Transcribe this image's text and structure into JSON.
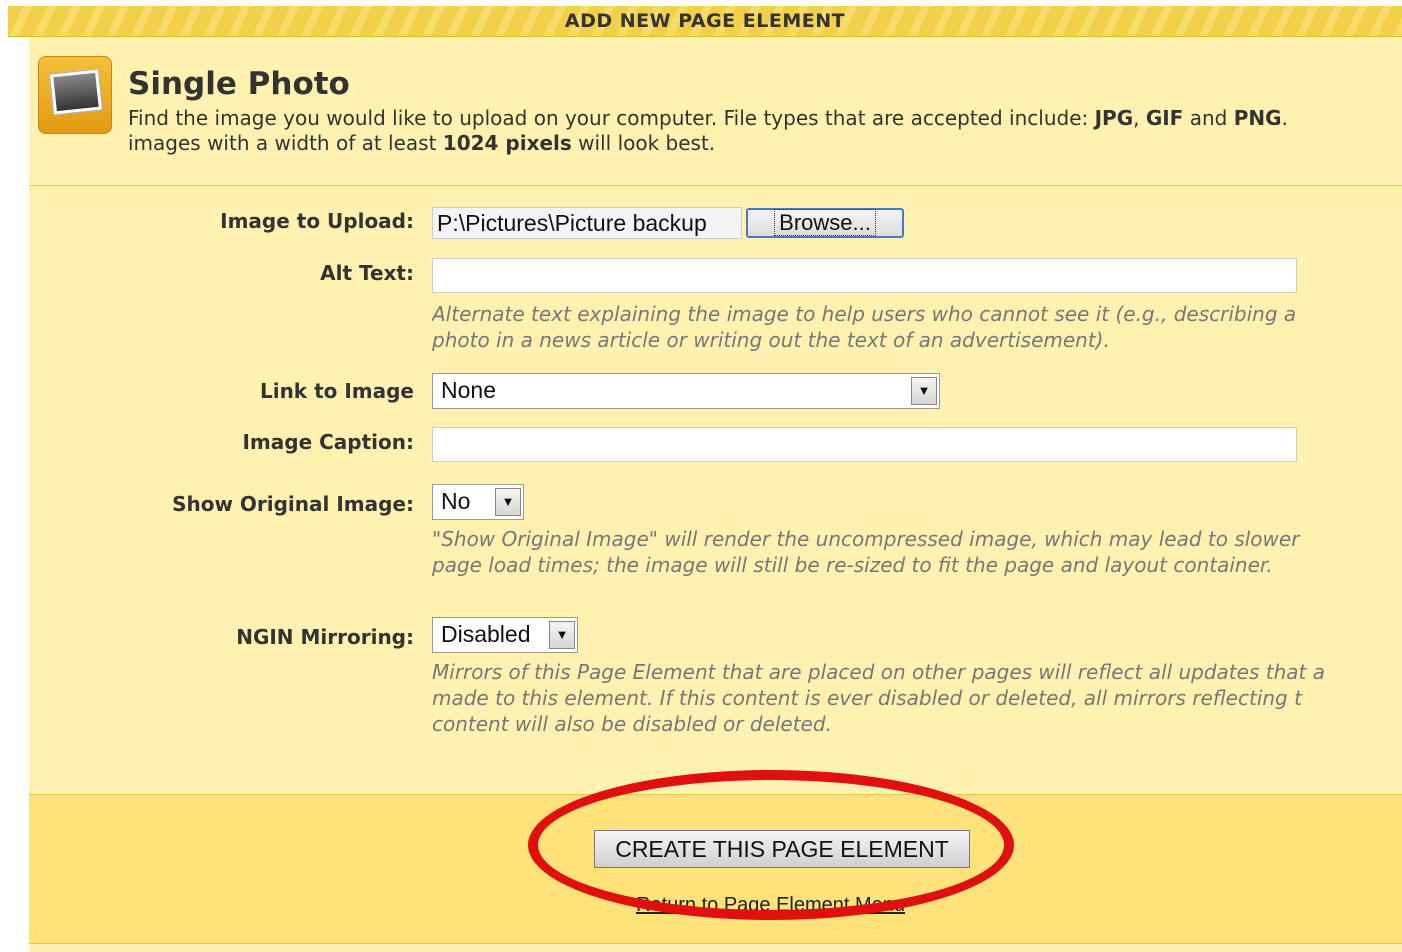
{
  "header": {
    "title": "ADD NEW PAGE ELEMENT"
  },
  "element": {
    "title": "Single Photo",
    "icon": "photo-icon",
    "desc_line1_a": "Find the image you would like to upload on your computer. File types that are accepted include: ",
    "desc_jpg": "JPG",
    "desc_comma": ", ",
    "desc_gif": "GIF",
    "desc_and": " and ",
    "desc_png": "PNG",
    "desc_period": ".",
    "desc_line2_a": "images with a width of at least ",
    "desc_pixels": "1024 pixels",
    "desc_line2_b": " will look best."
  },
  "form": {
    "image_upload": {
      "label": "Image to Upload:",
      "value": "P:\\Pictures\\Picture backup",
      "browse_label": "Browse..."
    },
    "alt_text": {
      "label": "Alt Text:",
      "value": "",
      "help_line1": "Alternate text explaining the image to help users who cannot see it (e.g., describing a",
      "help_line2": "photo in a news article or writing out the text of an advertisement)."
    },
    "link_to_image": {
      "label": "Link to Image",
      "selected": "None"
    },
    "image_caption": {
      "label": "Image Caption:",
      "value": ""
    },
    "show_original": {
      "label": "Show Original Image:",
      "selected": "No",
      "help_line1": "\"Show Original Image\" will render the uncompressed image, which may lead to slower",
      "help_line2": "page load times; the image will still be re-sized to fit the page and layout container."
    },
    "mirroring": {
      "label": "NGIN Mirroring:",
      "selected": "Disabled",
      "help_line1": "Mirrors of this Page Element that are placed on other pages will reflect all updates that a",
      "help_line2": "made to this element. If this content is ever disabled or deleted, all mirrors reflecting t",
      "help_line3": "content will also be disabled or deleted."
    }
  },
  "actions": {
    "create_label": "CREATE THIS PAGE ELEMENT",
    "return_label": "Return to Page Element Menu"
  },
  "colors": {
    "panel": "#fff2b0",
    "submit_area": "#ffe37a",
    "annotation": "#e01010"
  }
}
